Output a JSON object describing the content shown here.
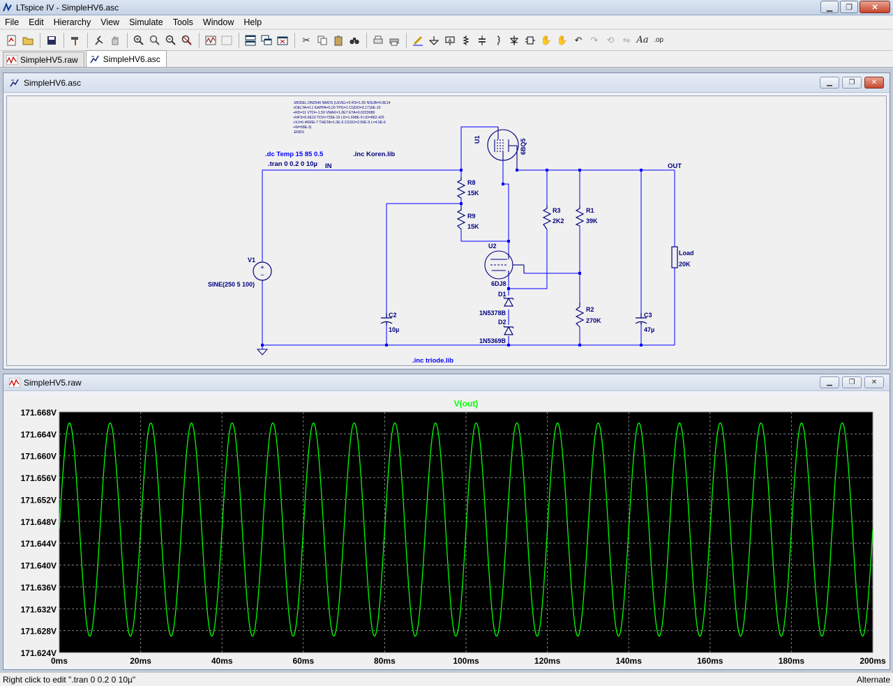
{
  "window": {
    "title": "LTspice IV - SimpleHV6.asc"
  },
  "menu": [
    "File",
    "Edit",
    "Hierarchy",
    "View",
    "Simulate",
    "Tools",
    "Window",
    "Help"
  ],
  "doc_tabs": [
    {
      "label": "SimpleHV5.raw",
      "icon": "waveform-icon",
      "active": false
    },
    {
      "label": "SimpleHV6.asc",
      "icon": "schematic-icon",
      "active": true
    }
  ],
  "schematic_window": {
    "title": "SimpleHV6.asc",
    "directives": {
      "model_lines": [
        ".MODEL DN2540    NMOS (LEVEL=3    RS=1.05          NSUB=5.0E14",
        "+DELTA=0.1       KAPPA=0.20       TPG=1           CGDO=3.1716E-10",
        "+RD=11           VTO=-1.50        VMAX=1.0E7      ETA=0.0223089",
        "+NFS=6.6E10      TOX=725E-10      LD=1.698E-9     UO=862.425",
        "+XJ=6.4666E-7    THETA=1.0E-5     CGSO=2.50E-9    L=4.0E-6",
        "+W=58E-3)",
        ".ENDS"
      ],
      "dc": ".dc Temp 15 85 0.5",
      "tran": ".tran 0 0.2 0 10µ",
      "inc_koren": ".inc Koren.lib",
      "inc_triode": ".inc triode.lib"
    },
    "nets": {
      "in": "IN",
      "out": "OUT"
    },
    "components": {
      "u1": {
        "ref": "U1",
        "value": "6BQ5"
      },
      "u2": {
        "ref": "U2",
        "value": "6DJ8"
      },
      "r8": {
        "ref": "R8",
        "value": "15K"
      },
      "r9": {
        "ref": "R9",
        "value": "15K"
      },
      "r3": {
        "ref": "R3",
        "value": "2K2"
      },
      "r1": {
        "ref": "R1",
        "value": "39K"
      },
      "r2": {
        "ref": "R2",
        "value": "270K"
      },
      "load": {
        "ref": "Load",
        "value": "20K"
      },
      "v1": {
        "ref": "V1",
        "value": "SINE(250 5 100)"
      },
      "c2": {
        "ref": "C2",
        "value": "10µ"
      },
      "c3": {
        "ref": "C3",
        "value": "47µ"
      },
      "d1": {
        "ref": "D1",
        "value": "1N5378B"
      },
      "d2": {
        "ref": "D2",
        "value": "1N5369B"
      }
    }
  },
  "waveform_window": {
    "title": "SimpleHV5.raw"
  },
  "chart_data": {
    "type": "line",
    "title": "V(out)",
    "x_unit": "ms",
    "y_unit": "V",
    "xlim": [
      0,
      200
    ],
    "ylim": [
      171.624,
      171.668
    ],
    "x_ticks": [
      0,
      20,
      40,
      60,
      80,
      100,
      120,
      140,
      160,
      180,
      200
    ],
    "y_ticks": [
      171.668,
      171.664,
      171.66,
      171.656,
      171.652,
      171.648,
      171.644,
      171.64,
      171.636,
      171.632,
      171.628,
      171.624
    ],
    "x_tick_labels": [
      "0ms",
      "20ms",
      "40ms",
      "60ms",
      "80ms",
      "100ms",
      "120ms",
      "140ms",
      "160ms",
      "180ms",
      "200ms"
    ],
    "y_tick_labels": [
      "171.668V",
      "171.664V",
      "171.660V",
      "171.656V",
      "171.652V",
      "171.648V",
      "171.644V",
      "171.640V",
      "171.636V",
      "171.632V",
      "171.628V",
      "171.624V"
    ],
    "grid": true,
    "series": [
      {
        "name": "V(out)",
        "color": "#00ff00",
        "frequency_hz": 100,
        "center": 171.6465,
        "amplitude": 0.0195,
        "start_phase": "rising-from-center",
        "sample_peaks_ms": [
          2.5,
          12.5,
          22.5,
          32.5,
          42.5,
          52.5,
          62.5,
          72.5,
          82.5,
          92.5,
          102.5,
          112.5,
          122.5,
          132.5,
          142.5,
          152.5,
          162.5,
          172.5,
          182.5,
          192.5
        ]
      }
    ]
  },
  "colors": {
    "plot_bg": "#000000",
    "trace": "#00ff00",
    "grid": "#808080",
    "wire": "#0000ff",
    "component": "#000080",
    "directive_blue": "#0000ff"
  },
  "status": {
    "left": "Right click to edit \".tran 0 0.2 0 10µ\"",
    "right": "Alternate"
  }
}
